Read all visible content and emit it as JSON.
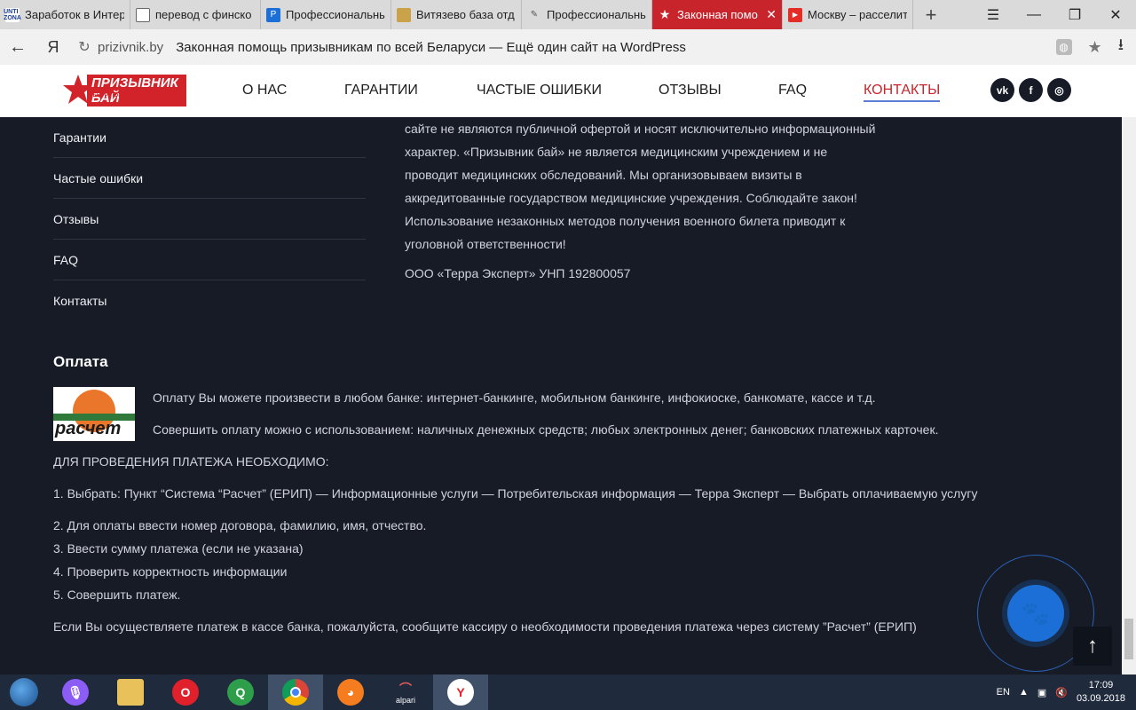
{
  "browser": {
    "tabs": [
      {
        "label": "Заработок в Интер",
        "icon": "unti-zona-icon",
        "active": false
      },
      {
        "label": "перевод с финско",
        "icon": "document-icon",
        "active": false
      },
      {
        "label": "Профессиональны",
        "icon": "blue-square-icon",
        "active": false
      },
      {
        "label": "Витязево база отд",
        "icon": "photo-icon",
        "active": false
      },
      {
        "label": "Профессиональны",
        "icon": "pen-icon",
        "active": false
      },
      {
        "label": "Законная помо",
        "icon": "star-icon",
        "active": true
      },
      {
        "label": "Москву – расселит",
        "icon": "youtube-icon",
        "active": false
      }
    ],
    "address": {
      "domain": "prizivnik.by",
      "title": "Законная помощь призывникам по всей Беларуси — Ещё один сайт на WordPress"
    }
  },
  "site": {
    "logo": {
      "title": "ПРИЗЫВНИК БАЙ",
      "subtitle": "ЦЕНТР ПОМОЩИ ПРИЗЫВНИКАМ"
    },
    "nav": [
      "О НАС",
      "ГАРАНТИИ",
      "ЧАСТЫЕ ОШИБКИ",
      "ОТЗЫВЫ",
      "FAQ",
      "КОНТАКТЫ"
    ],
    "socials": [
      "vk",
      "f",
      "ig"
    ]
  },
  "footer_menu": [
    "Гарантии",
    "Частые ошибки",
    "Отзывы",
    "FAQ",
    "Контакты"
  ],
  "disclaimer": [
    "сайте не являются публичной офертой и носят исключительно информационный",
    "характер. «Призывник бай» не является медицинским учреждением и не",
    "проводит медицинских обследований. Мы организовываем визиты в",
    "аккредитованные государством медицинские учреждения. Соблюдайте закон!",
    "Использование незаконных методов получения военного билета приводит к",
    "уголовной ответственности!"
  ],
  "company": "ООО «Терра Эксперт» УНП 192800057",
  "payment": {
    "title": "Оплата",
    "logo_word": "расчет",
    "line1": "Оплату Вы можете произвести в любом банке: интернет-банкинге, мобильном банкинге, инфокиоске, банкомате, кассе и т.д.",
    "line2": "Совершить оплату можно с использованием: наличных денежных средств; любых электронных денег; банковских платежных карточек.",
    "need": "ДЛЯ ПРОВЕДЕНИЯ ПЛАТЕЖА НЕОБХОДИМО:",
    "steps": [
      "1. Выбрать: Пункт “Система “Расчет” (ЕРИП) — Информационные услуги — Потребительская информация — Терра Эксперт — Выбрать оплачиваемую услугу",
      "2. Для оплаты ввести номер договора, фамилию, имя, отчество.",
      "3. Ввести сумму платежа (если не указана)",
      "4. Проверить корректность информации",
      "5. Совершить платеж."
    ],
    "cash": "Если Вы осуществляете платеж в кассе банка, пожалуйста, сообщите кассиру о необходимости проведения платежа через систему ”Расчет” (ЕРИП)"
  },
  "taskbar": {
    "apps": [
      "microphone",
      "explorer",
      "opera",
      "q",
      "chrome",
      "firefox",
      "alpari",
      "yandex"
    ],
    "alpari_label": "alpari",
    "lang": "EN",
    "time": "17:09",
    "date": "03.09.2018"
  }
}
